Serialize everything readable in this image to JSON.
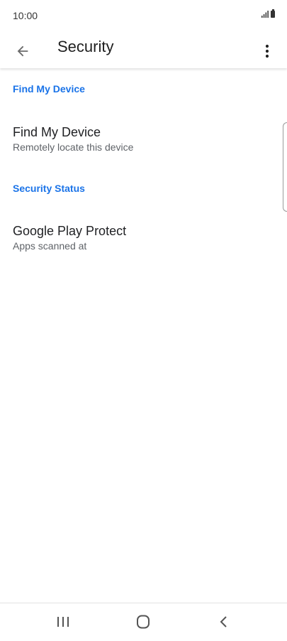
{
  "status_bar": {
    "time": "10:00"
  },
  "app_bar": {
    "title": "Security",
    "back_icon": "arrow-back-icon",
    "overflow_icon": "more-vert-icon"
  },
  "sections": [
    {
      "header": "Find My Device",
      "items": [
        {
          "title": "Find My Device",
          "summary": "Remotely locate this device"
        }
      ]
    },
    {
      "header": "Security Status",
      "items": [
        {
          "title": "Google Play Protect",
          "summary": "Apps scanned at"
        }
      ]
    }
  ],
  "nav_bar": {
    "recents_icon": "recents-icon",
    "home_icon": "home-icon",
    "back_icon": "back-chevron-icon"
  },
  "colors": {
    "accent": "#1a73e8",
    "title_text": "#202124",
    "summary_text": "#5f6368"
  }
}
